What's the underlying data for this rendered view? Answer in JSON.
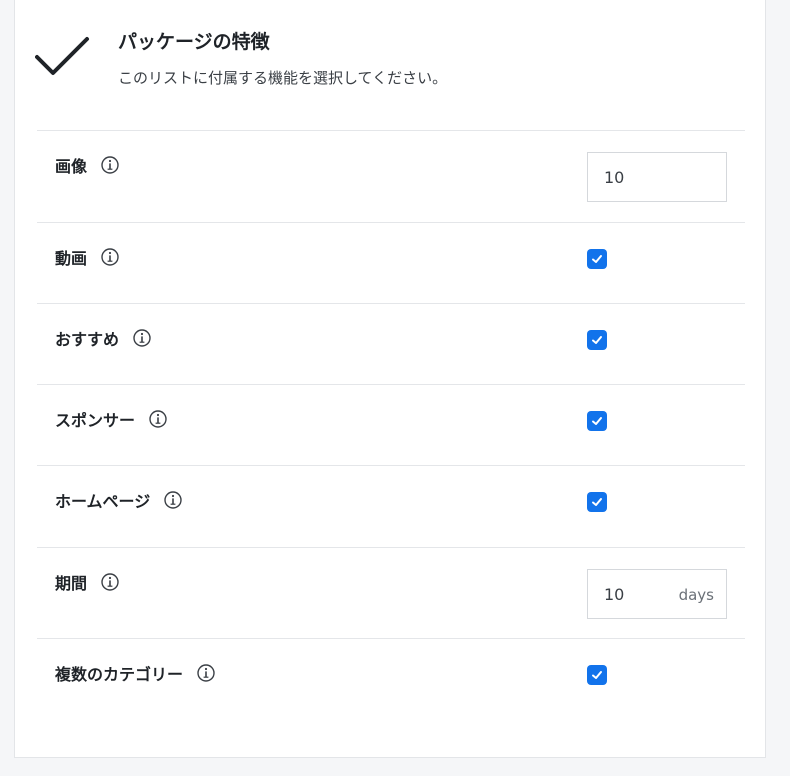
{
  "header": {
    "title": "パッケージの特徴",
    "subtitle": "このリストに付属する機能を選択してください。"
  },
  "accent_color": "#1273eb",
  "icons": {
    "header": "checkmark-icon",
    "info": "info-circle-icon",
    "checkbox": "checkbox-checked-icon"
  },
  "features": [
    {
      "label": "画像",
      "control": "number",
      "value": "10"
    },
    {
      "label": "動画",
      "control": "checkbox",
      "checked": true
    },
    {
      "label": "おすすめ",
      "control": "checkbox",
      "checked": true
    },
    {
      "label": "スポンサー",
      "control": "checkbox",
      "checked": true
    },
    {
      "label": "ホームページ",
      "control": "checkbox",
      "checked": true
    },
    {
      "label": "期間",
      "control": "number-suffix",
      "value": "10",
      "suffix": "days"
    },
    {
      "label": "複数のカテゴリー",
      "control": "checkbox",
      "checked": true
    }
  ]
}
